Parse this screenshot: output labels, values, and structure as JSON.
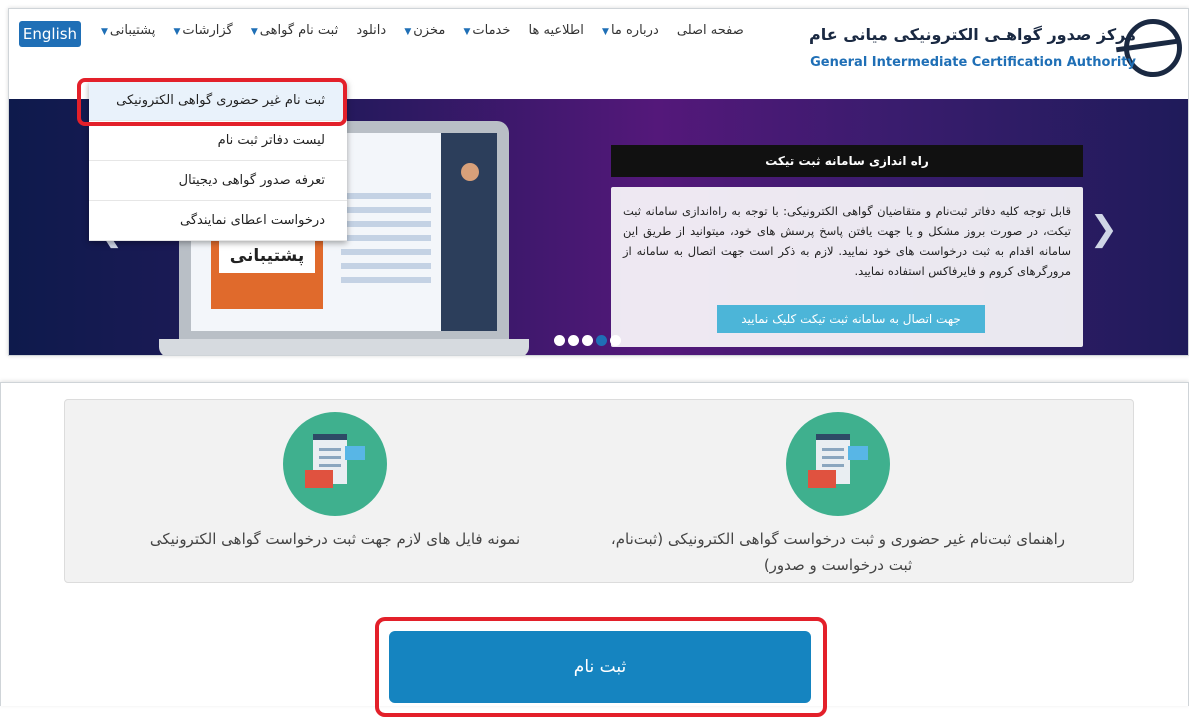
{
  "header": {
    "lang_button": "English",
    "logo_fa": "مرکز صدور گواهـی الکترونیکی میانی عام",
    "logo_en": "General Intermediate Certification Authority",
    "nav": [
      {
        "label": "صفحه اصلی",
        "caret": false
      },
      {
        "label": "درباره ما",
        "caret": true
      },
      {
        "label": "اطلاعیه ها",
        "caret": false
      },
      {
        "label": "خدمات",
        "caret": true
      },
      {
        "label": "مخزن",
        "caret": true
      },
      {
        "label": "دانلود",
        "caret": false
      },
      {
        "label": "ثبت نام گواهی",
        "caret": true
      },
      {
        "label": "گزارشات",
        "caret": true
      },
      {
        "label": "پشتیبانی",
        "caret": true
      }
    ]
  },
  "dropdown": {
    "items": [
      "ثبت نام غیر حضوری گواهی الکترونیکی",
      "لیست دفاتر ثبت نام",
      "تعرفه صدور گواهی دیجیتال",
      "درخواست اعطای نمایندگی"
    ]
  },
  "slider": {
    "ballot_label": "پشتیبانی",
    "news_title": "راه اندازی سامانه ثبت تیکت",
    "news_text": "قابل توجه کلیه دفاتر ثبت‌نام و متقاضیان گواهی الکترونیکی: با توجه به راه‌اندازی سامانه ثبت تیکت، در صورت بروز مشکل و یا جهت یافتن پاسخ پرسش های خود، میتوانید از طریق این سامانه اقدام به ثبت درخواست های خود نمایید. لازم به ذکر است جهت اتصال به سامانه از مرورگرهای کروم و فایرفاکس استفاده نمایید.",
    "news_button": "جهت اتصال به سامانه ثبت تیکت کلیک نمایید",
    "prev_arrow": "❮",
    "next_arrow": "❯"
  },
  "docs": {
    "item1": "راهنمای ثبت‌نام غیر حضوری و ثبت درخواست گواهی الکترونیکی (ثبت‌نام، ثبت درخواست و صدور)",
    "item2": "نمونه فایل های لازم جهت ثبت درخواست گواهی الکترونیکی"
  },
  "register_button": "ثبت نام",
  "colors": {
    "accent": "#1584c0",
    "highlight": "#e3202a",
    "icon_circle": "#3fb08e"
  }
}
